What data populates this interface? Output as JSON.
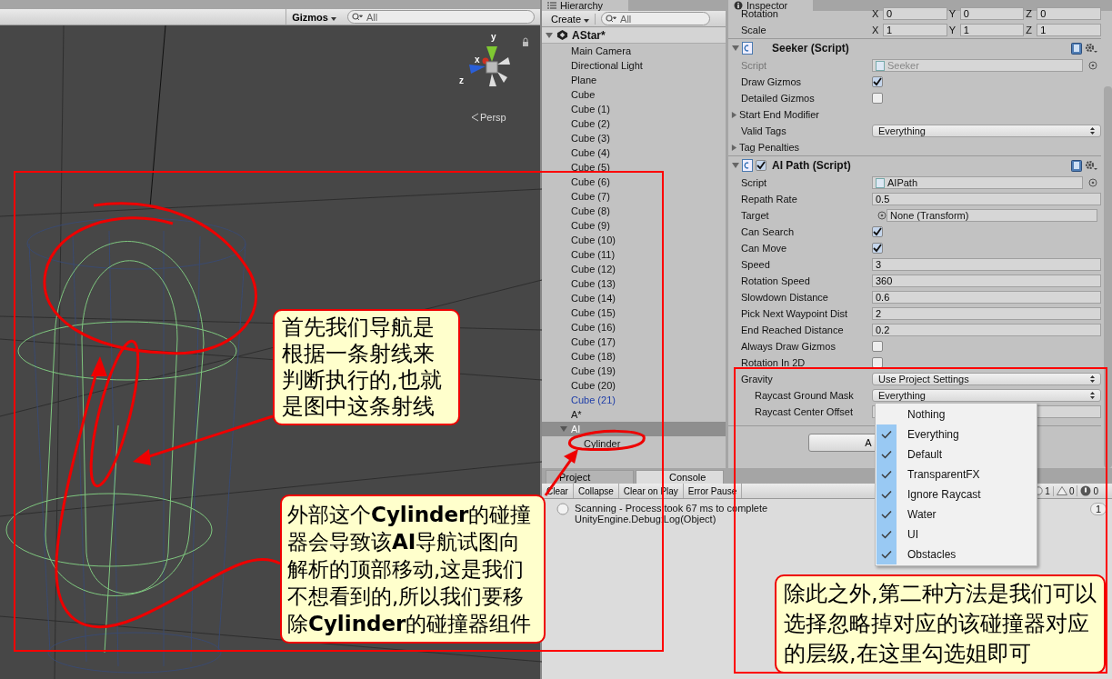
{
  "scene": {
    "gizmos": "Gizmos",
    "search_placeholder": "All",
    "axes": [
      "y",
      "x",
      "z"
    ],
    "view": "Persp"
  },
  "hierarchy": {
    "tab": "Hierarchy",
    "create": "Create",
    "search_placeholder": "All",
    "scene": {
      "name": "AStar*",
      "expanded": true
    },
    "items": [
      {
        "name": "Main Camera",
        "selected": false,
        "prefab": false
      },
      {
        "name": "Directional Light",
        "selected": false,
        "prefab": false
      },
      {
        "name": "Plane",
        "selected": false,
        "prefab": false
      },
      {
        "name": "Cube",
        "selected": false,
        "prefab": false
      },
      {
        "name": "Cube (1)",
        "selected": false,
        "prefab": false
      },
      {
        "name": "Cube (2)",
        "selected": false,
        "prefab": false
      },
      {
        "name": "Cube (3)",
        "selected": false,
        "prefab": false
      },
      {
        "name": "Cube (4)",
        "selected": false,
        "prefab": false
      },
      {
        "name": "Cube (5)",
        "selected": false,
        "prefab": false
      },
      {
        "name": "Cube (6)",
        "selected": false,
        "prefab": false
      },
      {
        "name": "Cube (7)",
        "selected": false,
        "prefab": false
      },
      {
        "name": "Cube (8)",
        "selected": false,
        "prefab": false
      },
      {
        "name": "Cube (9)",
        "selected": false,
        "prefab": false
      },
      {
        "name": "Cube (10)",
        "selected": false,
        "prefab": false
      },
      {
        "name": "Cube (11)",
        "selected": false,
        "prefab": false
      },
      {
        "name": "Cube (12)",
        "selected": false,
        "prefab": false
      },
      {
        "name": "Cube (13)",
        "selected": false,
        "prefab": false
      },
      {
        "name": "Cube (14)",
        "selected": false,
        "prefab": false
      },
      {
        "name": "Cube (15)",
        "selected": false,
        "prefab": false
      },
      {
        "name": "Cube (16)",
        "selected": false,
        "prefab": false
      },
      {
        "name": "Cube (17)",
        "selected": false,
        "prefab": false
      },
      {
        "name": "Cube (18)",
        "selected": false,
        "prefab": false
      },
      {
        "name": "Cube (19)",
        "selected": false,
        "prefab": false
      },
      {
        "name": "Cube (20)",
        "selected": false,
        "prefab": false
      },
      {
        "name": "Cube (21)",
        "selected": false,
        "prefab": true
      },
      {
        "name": "A*",
        "selected": false,
        "prefab": false
      },
      {
        "name": "AI",
        "selected": true,
        "prefab": false,
        "expanded": true,
        "children": [
          {
            "name": "Cylinder",
            "selected": false,
            "prefab": false
          }
        ]
      }
    ]
  },
  "inspector": {
    "tab": "Inspector",
    "transform": [
      {
        "label": "Rotation",
        "fields": [
          {
            "axis": "X",
            "value": "0"
          },
          {
            "axis": "Y",
            "value": "0"
          },
          {
            "axis": "Z",
            "value": "0"
          }
        ]
      },
      {
        "label": "Scale",
        "fields": [
          {
            "axis": "X",
            "value": "1"
          },
          {
            "axis": "Y",
            "value": "1"
          },
          {
            "axis": "Z",
            "value": "1"
          }
        ]
      }
    ],
    "components": [
      {
        "title": "Seeker (Script)",
        "expanded": true,
        "fields": [
          {
            "kind": "script",
            "label": "Script",
            "value": "Seeker",
            "disabled": true
          },
          {
            "kind": "checkbox",
            "label": "Draw Gizmos",
            "checked": true
          },
          {
            "kind": "checkbox",
            "label": "Detailed Gizmos",
            "checked": false
          },
          {
            "kind": "foldout",
            "label": "Start End Modifier",
            "expanded": false
          },
          {
            "kind": "dropdown",
            "label": "Valid Tags",
            "value": "Everything"
          },
          {
            "kind": "foldout",
            "label": "Tag Penalties",
            "expanded": false
          }
        ]
      },
      {
        "title": "AI Path (Script)",
        "expanded": true,
        "enabled": true,
        "fields": [
          {
            "kind": "script",
            "label": "Script",
            "value": "AIPath",
            "disabled": false
          },
          {
            "kind": "text",
            "label": "Repath Rate",
            "value": "0.5"
          },
          {
            "kind": "object",
            "label": "Target",
            "value": "None (Transform)"
          },
          {
            "kind": "checkbox",
            "label": "Can Search",
            "checked": true
          },
          {
            "kind": "checkbox",
            "label": "Can Move",
            "checked": true
          },
          {
            "kind": "text",
            "label": "Speed",
            "value": "3"
          },
          {
            "kind": "text",
            "label": "Rotation Speed",
            "value": "360"
          },
          {
            "kind": "text",
            "label": "Slowdown Distance",
            "value": "0.6"
          },
          {
            "kind": "text",
            "label": "Pick Next Waypoint Dist",
            "value": "2"
          },
          {
            "kind": "text",
            "label": "End Reached Distance",
            "value": "0.2"
          },
          {
            "kind": "checkbox",
            "label": "Always Draw Gizmos",
            "checked": false
          },
          {
            "kind": "checkbox",
            "label": "Rotation In 2D",
            "checked": false
          },
          {
            "kind": "dropdown",
            "label": "Gravity",
            "value": "Use Project Settings",
            "children": [
              {
                "kind": "dropdown",
                "label": "Raycast Ground Mask",
                "value": "Everything"
              },
              {
                "kind": "text",
                "label": "Raycast Center Offset"
              }
            ]
          }
        ]
      }
    ],
    "add_button": "A",
    "mask_menu": [
      {
        "label": "Nothing",
        "checked": false
      },
      {
        "label": "Everything",
        "checked": true
      },
      {
        "label": "Default",
        "checked": true
      },
      {
        "label": "TransparentFX",
        "checked": true
      },
      {
        "label": "Ignore Raycast",
        "checked": true
      },
      {
        "label": "Water",
        "checked": true
      },
      {
        "label": "UI",
        "checked": true
      },
      {
        "label": "Obstacles",
        "checked": true
      }
    ]
  },
  "console": {
    "tabs": [
      {
        "label": "Project",
        "selected": false
      },
      {
        "label": "Console",
        "selected": true
      }
    ],
    "buttons": [
      "Clear",
      "Collapse",
      "Clear on Play",
      "Error Pause"
    ],
    "counts": {
      "info": "1",
      "warnings": "0",
      "errors": "0"
    },
    "entries": [
      {
        "message": "Scanning - Process took 67 ms to complete",
        "trace": "UnityEngine.Debug:Log(Object)",
        "count": "1"
      }
    ]
  },
  "callouts": [
    "首先我们导航是根据一条射线来判断执行的,也就是图中这条射线",
    "外部这个**Cylinder**的碰撞器会导致该**AI**导航试图向解析的顶部移动,这是我们不想看到的,所以我们要移除**Cylinder**的碰撞器组件",
    "除此之外,第二种方法是我们可以选择忽略掉对应的该碰撞器对应的层级,在这里勾选姐即可"
  ]
}
